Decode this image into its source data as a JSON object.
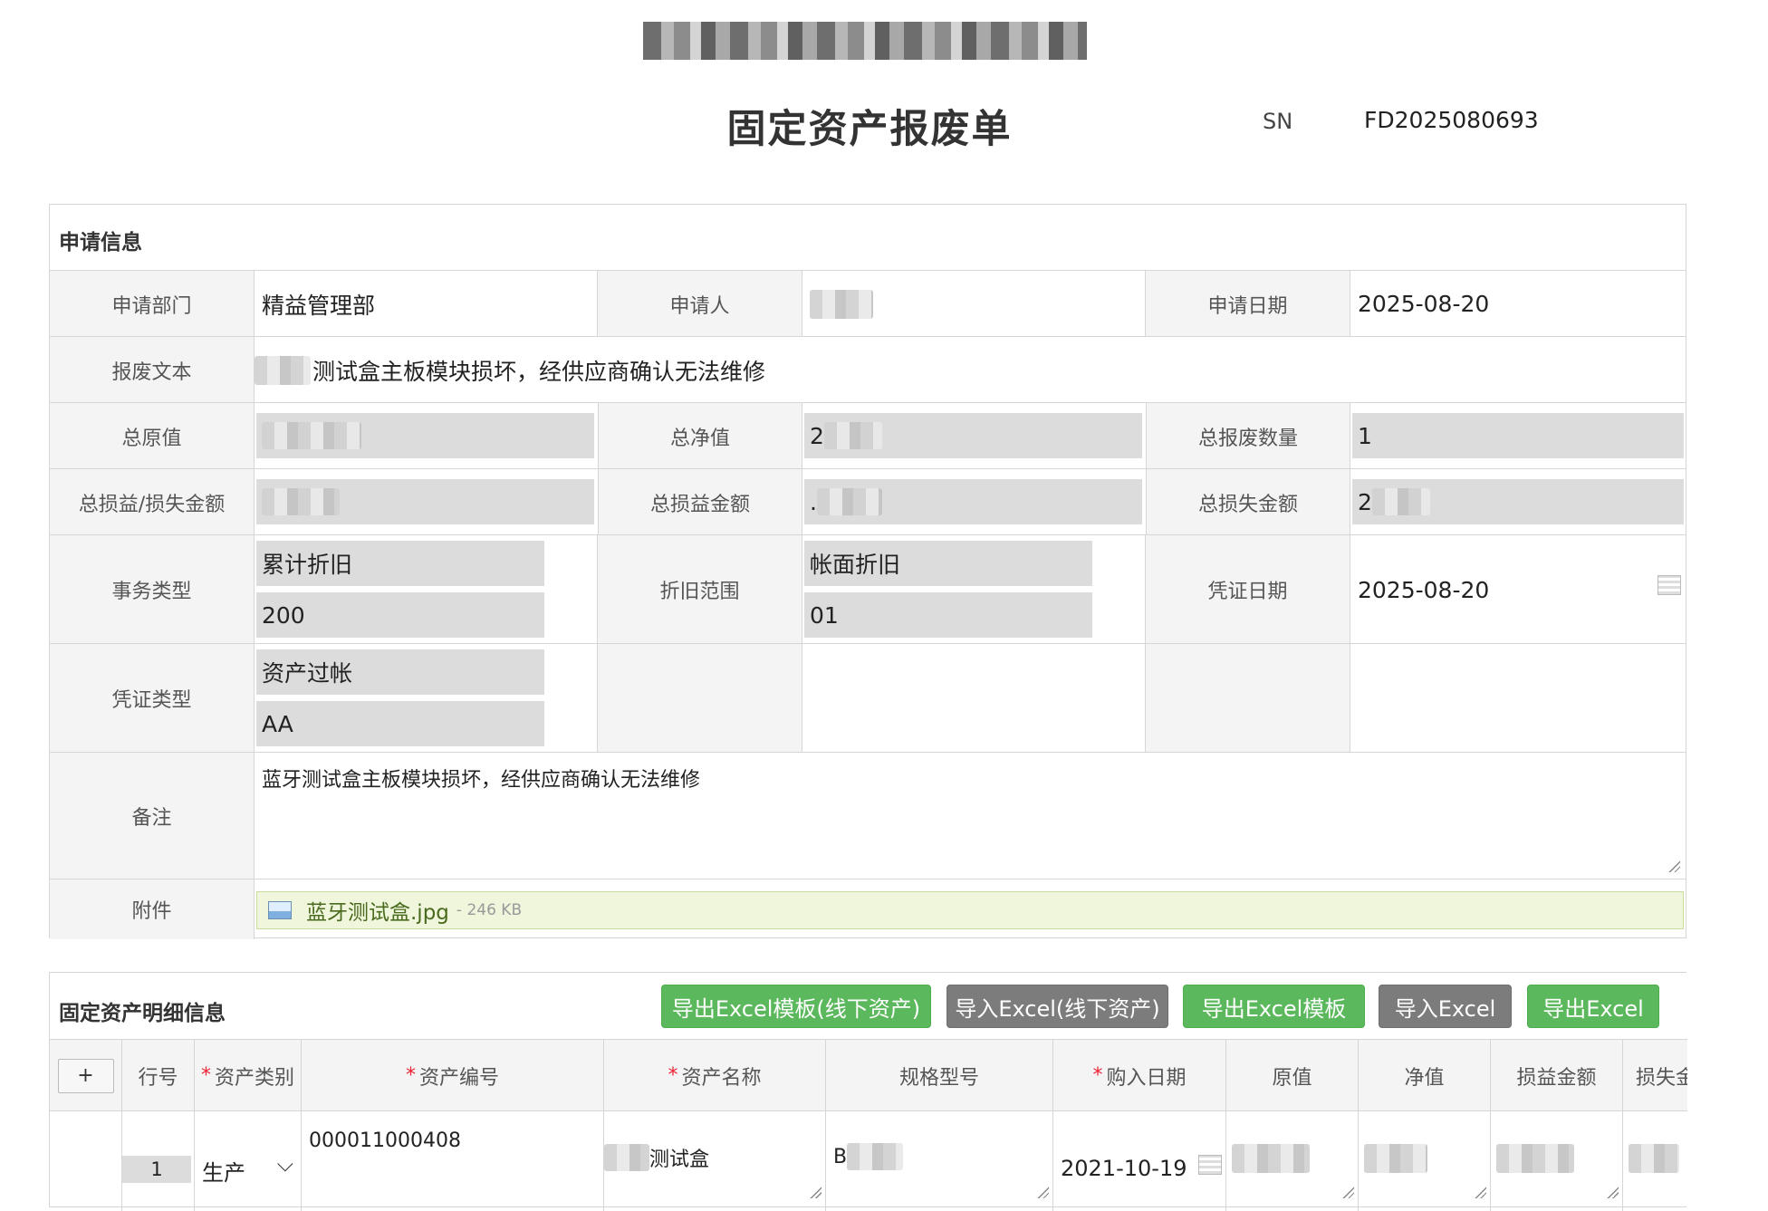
{
  "form": {
    "title": "固定资产报废单",
    "sn_label": "SN",
    "sn_value": "FD2025080693"
  },
  "apply": {
    "section_title": "申请信息",
    "dept_label": "申请部门",
    "dept_value": "精益管理部",
    "applicant_label": "申请人",
    "date_label": "申请日期",
    "date_value": "2025-08-20",
    "text_label": "报废文本",
    "text_value": "测试盒主板模块损坏，经供应商确认无法维修",
    "orig_label": "总原值",
    "net_label": "总净值",
    "net_value_prefix": "2",
    "qty_label": "总报废数量",
    "qty_value": "1",
    "pl_label": "总损益/损失金额",
    "gain_label": "总损益金额",
    "gain_value_prefix": ".",
    "loss_label": "总损失金额",
    "loss_value_prefix": "2",
    "txn_label": "事务类型",
    "txn_name": "累计折旧",
    "txn_code": "200",
    "dep_label": "折旧范围",
    "dep_name": "帐面折旧",
    "dep_code": "01",
    "voucher_date_label": "凭证日期",
    "voucher_date_value": "2025-08-20",
    "voucher_type_label": "凭证类型",
    "voucher_type_name": "资产过帐",
    "voucher_type_code": "AA",
    "remark_label": "备注",
    "remark_value": "蓝牙测试盒主板模块损坏，经供应商确认无法维修",
    "attach_label": "附件",
    "attach_name": "蓝牙测试盒.jpg",
    "attach_size": "- 246 KB"
  },
  "detail": {
    "section_title": "固定资产明细信息",
    "buttons": {
      "export_tpl_offline": "导出Excel模板(线下资产)",
      "import_offline": "导入Excel(线下资产)",
      "export_tpl": "导出Excel模板",
      "import": "导入Excel",
      "export": "导出Excel"
    },
    "add_symbol": "+",
    "columns": {
      "row_no": "行号",
      "category": "资产类别",
      "asset_no": "资产编号",
      "asset_name": "资产名称",
      "spec": "规格型号",
      "purchase_date": "购入日期",
      "orig": "原值",
      "net": "净值",
      "gain": "损益金额",
      "loss": "损失金"
    },
    "required_mark": "*",
    "row": {
      "row_no": "1",
      "category": "生产",
      "category_arrow": "⌵",
      "asset_no": "000011000408",
      "asset_name_suffix": "测试盒",
      "spec_prefix": "B",
      "purchase_date": "2021-10-19"
    }
  }
}
